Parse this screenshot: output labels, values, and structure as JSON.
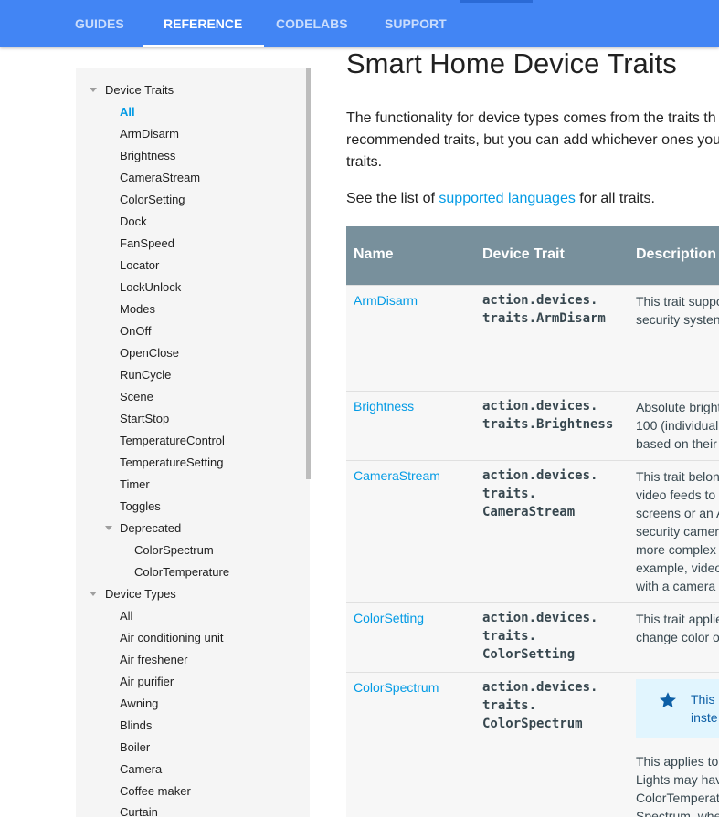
{
  "topnav": {
    "tabs": [
      {
        "label": "GUIDES"
      },
      {
        "label": "REFERENCE"
      },
      {
        "label": "CODELABS"
      },
      {
        "label": "SUPPORT"
      }
    ],
    "active_tab": "REFERENCE"
  },
  "sidebar": {
    "device_traits": {
      "heading": "Device Traits",
      "items": [
        "All",
        "ArmDisarm",
        "Brightness",
        "CameraStream",
        "ColorSetting",
        "Dock",
        "FanSpeed",
        "Locator",
        "LockUnlock",
        "Modes",
        "OnOff",
        "OpenClose",
        "RunCycle",
        "Scene",
        "StartStop",
        "TemperatureControl",
        "TemperatureSetting",
        "Timer",
        "Toggles"
      ],
      "active_item": "All",
      "deprecated": {
        "heading": "Deprecated",
        "items": [
          "ColorSpectrum",
          "ColorTemperature"
        ]
      }
    },
    "device_types": {
      "heading": "Device Types",
      "items": [
        "All",
        "Air conditioning unit",
        "Air freshener",
        "Air purifier",
        "Awning",
        "Blinds",
        "Boiler",
        "Camera",
        "Coffee maker",
        "Curtain"
      ]
    }
  },
  "main": {
    "title": "Smart Home Device Traits",
    "intro_lines": [
      "The functionality for device types comes from the traits th",
      "recommended traits, but you can add whichever ones you",
      "traits."
    ],
    "see_list": {
      "before": "See the list of ",
      "link": "supported languages",
      "after": " for all traits."
    },
    "table": {
      "headers": [
        "Name",
        "Device Trait",
        "Description"
      ],
      "rows": [
        {
          "name": "ArmDisarm",
          "code": [
            "action.devices.",
            "traits.ArmDisarm"
          ],
          "desc": [
            "This trait suppo",
            "security systen"
          ]
        },
        {
          "name": "Brightness",
          "code": [
            "action.devices.",
            "traits.Brightness"
          ],
          "desc": [
            "Absolute bright",
            "100 (individual",
            "based on their"
          ]
        },
        {
          "name": "CameraStream",
          "code": [
            "action.devices.",
            "traits.",
            "CameraStream"
          ],
          "desc": [
            "This trait belon",
            "video feeds to",
            "screens or an A",
            "security camer",
            "more complex",
            "example, video",
            "with a camera"
          ]
        },
        {
          "name": "ColorSetting",
          "code": [
            "action.devices.",
            "traits.",
            "ColorSetting"
          ],
          "desc": [
            "This trait applie",
            "change color o"
          ]
        },
        {
          "name": "ColorSpectrum",
          "code": [
            "action.devices.",
            "traits.",
            "ColorSpectrum"
          ],
          "note": [
            "This",
            "inste"
          ],
          "desc": [
            "This applies to",
            "Lights may hav",
            "ColorTemperat",
            "Spectrum, whe"
          ]
        }
      ]
    }
  },
  "colors": {
    "nav_bar": "#4285f4",
    "link": "#039be5",
    "table_header": "#78909c",
    "note_bg": "#e1f5fe",
    "note_icon": "#0d5fa6"
  },
  "icons": {
    "tree_toggle": "caret-down-icon",
    "note": "star-icon"
  }
}
